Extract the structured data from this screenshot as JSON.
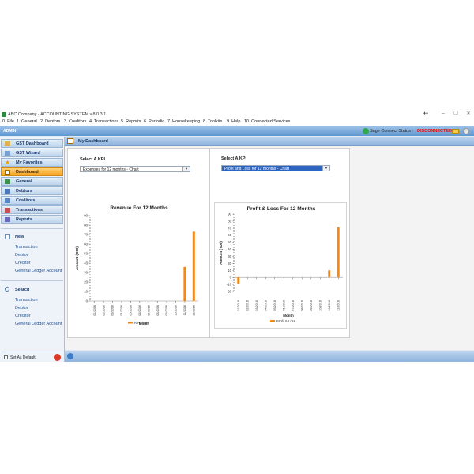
{
  "window": {
    "title": "ABC Company - ACCOUNTING SYSTEM v.8.0.3.1",
    "controls": {
      "extra": "♦♦",
      "minimize": "–",
      "restore": "❐",
      "close": "✕"
    }
  },
  "menu": [
    "0. File",
    "1. General",
    "2. Debtors",
    "3. Creditors",
    "4. Transactions",
    "5. Reports",
    "6. Periodic",
    "7. Housekeeping",
    "8. Toolkits",
    "9. Help",
    "10. Connected Services"
  ],
  "topbar": {
    "user": "ADMIN",
    "sage_status_label": "Sage Connect Status :",
    "sage_status_value": "DISCONNECTED"
  },
  "sidebar": {
    "items": [
      {
        "label": "GST Dashboard",
        "icon": "gst-dashboard-icon"
      },
      {
        "label": "GST Wizard",
        "icon": "gst-wizard-icon"
      },
      {
        "label": "My Favorites",
        "icon": "star-icon"
      },
      {
        "label": "Dashboard",
        "icon": "dashboard-icon",
        "active": true
      },
      {
        "label": "General",
        "icon": "general-icon"
      },
      {
        "label": "Debtors",
        "icon": "debtors-icon"
      },
      {
        "label": "Creditors",
        "icon": "creditors-icon"
      },
      {
        "label": "Transactions",
        "icon": "transactions-icon"
      },
      {
        "label": "Reports",
        "icon": "reports-icon"
      }
    ],
    "new": {
      "title": "New",
      "links": [
        "Transaction",
        "Debtor",
        "Creditor",
        "General Ledger Account"
      ]
    },
    "search": {
      "title": "Search",
      "links": [
        "Transaction",
        "Debtor",
        "Creditor",
        "General Ledger Account"
      ]
    },
    "set_default": "Set As Default"
  },
  "content": {
    "title": "My Dashboard"
  },
  "kpi_left": {
    "label": "Select A KPI",
    "selected": "Expenses for 12 months - Chart"
  },
  "kpi_right": {
    "label": "Select A KPI",
    "selected": "Profit and Loss for 12 months - Chart"
  },
  "colors": {
    "bar": "#f28a18",
    "accent": "#5f97d0",
    "active": "#f5a21c",
    "disconnected": "#dd1111"
  },
  "chart_data": [
    {
      "type": "bar",
      "title": "Revenue For 12 Months",
      "xlabel": "Month",
      "ylabel": "Amount ('000)",
      "ylim": [
        0,
        90
      ],
      "yticks": [
        0,
        10,
        20,
        30,
        40,
        50,
        60,
        70,
        80,
        90
      ],
      "categories": [
        "01/2016",
        "02/2016",
        "03/2016",
        "04/2016",
        "05/2016",
        "06/2016",
        "07/2016",
        "08/2016",
        "09/2016",
        "10/2016",
        "11/2016",
        "12/2016"
      ],
      "series": [
        {
          "name": "Revenue",
          "values": [
            0,
            0,
            0,
            0,
            0,
            0,
            0,
            0,
            0,
            0,
            36,
            73
          ]
        }
      ]
    },
    {
      "type": "bar",
      "title": "Profit & Loss For 12 Months",
      "xlabel": "Month",
      "ylabel": "Amount ('000)",
      "ylim": [
        -20,
        90
      ],
      "yticks": [
        -20,
        -10,
        0,
        10,
        20,
        30,
        40,
        50,
        60,
        70,
        80,
        90
      ],
      "categories": [
        "01/2016",
        "02/2016",
        "03/2016",
        "04/2016",
        "05/2016",
        "06/2016",
        "07/2016",
        "08/2016",
        "09/2016",
        "10/2016",
        "11/2016",
        "12/2016"
      ],
      "series": [
        {
          "name": "Profit & Loss",
          "values": [
            -9,
            0,
            0,
            0,
            0,
            0,
            0,
            0,
            0,
            0,
            10,
            72
          ]
        }
      ]
    }
  ]
}
